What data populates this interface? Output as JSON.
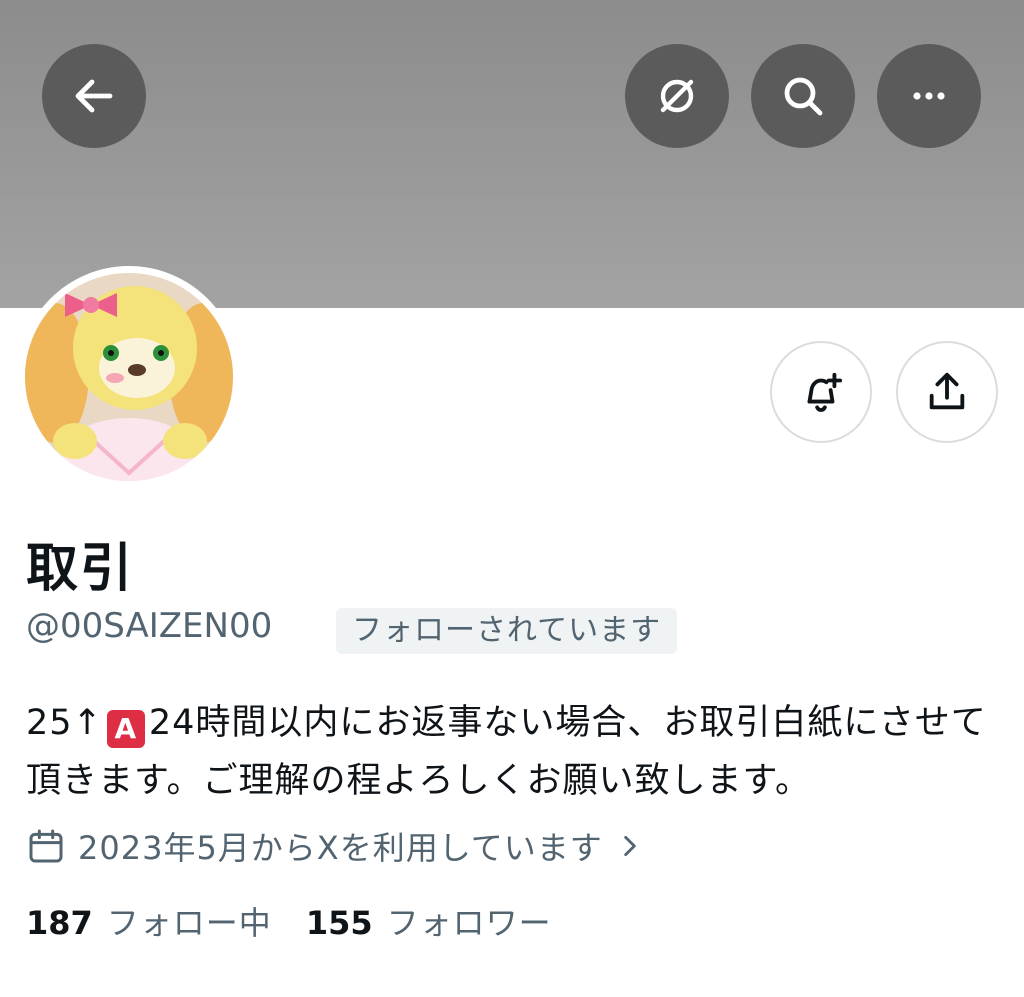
{
  "header": {
    "back_icon": "arrow-left-icon",
    "grok_icon": "grok-icon",
    "search_icon": "search-icon",
    "more_icon": "more-horizontal-icon"
  },
  "profile": {
    "display_name": "取引",
    "handle": "@00SAIZEN00",
    "follows_you_badge": "フォローされています",
    "bio_prefix": "25↑",
    "bio_emoji": "A",
    "bio_rest": "24時間以内にお返事ない場合、お取引白紙にさせて頂きます。ご理解の程よろしくお願い致します。",
    "joined": "2023年5月からXを利用しています",
    "following_count": "187",
    "following_label": "フォロー中",
    "followers_count": "155",
    "followers_label": "フォロワー"
  },
  "actions": {
    "notify_icon": "bell-plus-icon",
    "share_icon": "share-icon"
  },
  "colors": {
    "banner": "#999999",
    "header_button": "#5b5b5b",
    "secondary_text": "#536471",
    "badge_bg": "#eff3f4",
    "emoji_red": "#dd2e44"
  }
}
